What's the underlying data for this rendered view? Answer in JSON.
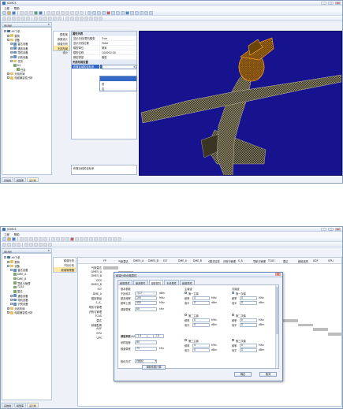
{
  "app": {
    "title": "SOMCS"
  },
  "menu": [
    "工程",
    "帮助"
  ],
  "tree_panel": {
    "title": "设计树"
  },
  "tree": {
    "items": [
      {
        "label": "XX飞机 ",
        "level": 0,
        "icon": "root-icon",
        "exp": "-"
      },
      {
        "label": "载荷",
        "level": 1,
        "icon": "folder-icon",
        "exp": "+"
      },
      {
        "label": "设备",
        "level": 1,
        "icon": "folder-icon",
        "exp": "-"
      },
      {
        "label": "雷达设备",
        "level": 2,
        "icon": "device-icon",
        "exp": "+"
      },
      {
        "label": "通信设备",
        "level": 2,
        "icon": "device-icon",
        "exp": "+"
      },
      {
        "label": "导航设备",
        "level": 2,
        "icon": "device-icon",
        "exp": "+"
      },
      {
        "label": "识别设备",
        "level": 2,
        "icon": "device-icon",
        "exp": "+"
      },
      {
        "label": "任务",
        "level": 2,
        "icon": "folder-icon",
        "exp": "-"
      },
      {
        "label": "N1",
        "level": 3,
        "icon": "module-icon",
        "exp": ""
      },
      {
        "label": "任务",
        "level": 4,
        "icon": "module-icon",
        "exp": ""
      },
      {
        "label": "天线布局",
        "level": 1,
        "icon": "folder-icon",
        "exp": "+"
      },
      {
        "label": "电磁兼容性分析",
        "level": 1,
        "icon": "folder-icon",
        "exp": "+"
      }
    ],
    "items2": [
      {
        "label": "XX飞机 ",
        "level": 0,
        "icon": "root-icon",
        "exp": "-"
      },
      {
        "label": "载荷",
        "level": 1,
        "icon": "folder-icon",
        "exp": "+"
      },
      {
        "label": "设备",
        "level": 1,
        "icon": "folder-icon",
        "exp": "-"
      },
      {
        "label": "雷达设备",
        "level": 2,
        "icon": "device-icon",
        "exp": "-"
      },
      {
        "label": "DME_A",
        "level": 3,
        "icon": "module-icon",
        "exp": ""
      },
      {
        "label": "DME_B",
        "level": 3,
        "icon": "module-icon",
        "exp": ""
      },
      {
        "label": "导航与管理",
        "level": 3,
        "icon": "module-icon",
        "exp": ""
      },
      {
        "label": "TCAS",
        "level": 3,
        "icon": "module-icon",
        "exp": ""
      },
      {
        "label": "雷达",
        "level": 3,
        "icon": "module-icon",
        "exp": ""
      },
      {
        "label": "通信设备",
        "level": 2,
        "icon": "device-icon",
        "exp": "+"
      },
      {
        "label": "导航设备",
        "level": 2,
        "icon": "device-icon",
        "exp": "+"
      },
      {
        "label": "识别设备",
        "level": 2,
        "icon": "device-icon",
        "exp": "+"
      },
      {
        "label": "天线布局",
        "level": 1,
        "icon": "folder-icon",
        "exp": "+"
      },
      {
        "label": "电磁兼容性分析",
        "level": 1,
        "icon": "folder-icon",
        "exp": "+"
      }
    ]
  },
  "bottom_tabs": [
    "系统树",
    "模型库",
    "设计树"
  ],
  "subnav": [
    "模型库",
    "参数设计",
    "频谱分析",
    "天线布局设计"
  ],
  "subnav2": [
    "频谱分析",
    "干扰分析",
    "频谱管理器"
  ],
  "properties": {
    "category": "属性列表",
    "rows": [
      {
        "k": "显示天线/载机模型",
        "v": "True"
      },
      {
        "k": "显示天线位置",
        "v": "False"
      },
      {
        "k": "模型单位",
        "v": "毫米"
      },
      {
        "k": "模型名称",
        "v": "100000.00"
      },
      {
        "k": "模型类型",
        "v": "模型"
      }
    ],
    "category2": "天线布局设置",
    "selected_key": "布置区域的坐标系",
    "dropdown_options": [
      "",
      "是",
      "否"
    ],
    "description": "布置天线的坐标系"
  },
  "grid": {
    "columns": [
      "FP",
      "气象雷达",
      "DME5_A",
      "DME5_B",
      "ELT",
      "DME_A",
      "DME_B",
      "S模式应答",
      "识别与管理",
      "S_A",
      "导航与管理",
      "TCAS",
      "雷达",
      "频段选择",
      "ADF",
      "GPU",
      "UPS"
    ],
    "rows": [
      "气象雷达",
      "DME5_A",
      "DME5_B",
      "DCS",
      "DME5_B",
      "ELT",
      "DME_A",
      "模拟物品",
      "S_A_",
      "导航与管理",
      "识别与管理",
      "TCAS",
      "雷达",
      "频谱配置",
      "ADF",
      "GPU",
      "UPS"
    ]
  },
  "dialog": {
    "title": "频谱分析设置属性",
    "tabs": [
      "频带属性",
      "谐波属性",
      "调制属性",
      "天线属性",
      "频谱属性"
    ],
    "active_tab": 2,
    "left": {
      "section": "基本参数",
      "fields": [
        {
          "label": "干扰电平",
          "value": "-117",
          "unit": "dBm"
        },
        {
          "label": "基本频率",
          "value": "100",
          "unit": "MHz"
        },
        {
          "label": "频率上限",
          "value": "400",
          "unit": "MHz"
        },
        {
          "label": "调制带宽",
          "value": "80",
          "unit": "kHz"
        },
        {
          "label": "增益系数",
          "value": "0",
          "unit": ""
        },
        {
          "label": "采样密度",
          "value": "80",
          "unit": ""
        },
        {
          "label": "频谱带宽",
          "value": "75",
          "unit": "kHz"
        }
      ],
      "coef_label": "调制系数(A/B)",
      "coef_a": "-1.4",
      "coef_b": "-1.4",
      "pol_label": "极化方式",
      "pol_value": "线极化",
      "calc_button": "调制系数计算"
    },
    "middle": {
      "section": "主谐波",
      "first": "第一主谐",
      "rows": [
        {
          "k": "频率",
          "v": "0",
          "u": "MHz"
        },
        {
          "k": "电平",
          "v": "0",
          "u": "dBm"
        }
      ],
      "second": "第二主谐",
      "third": "第三主谐",
      "k_freq": "频率",
      "k_level": "电平",
      "zero": "0",
      "mhz": "MHz",
      "dbm": "dBm"
    },
    "right": {
      "section": "次谐波",
      "first": "第一次谐",
      "second": "第二次谐",
      "third": "第三次谐",
      "k_freq": "频率",
      "k_level": "电平",
      "zero": "0",
      "mhz": "MHz",
      "dbm": "dBm"
    },
    "ok": "确定",
    "cancel": "取消"
  }
}
